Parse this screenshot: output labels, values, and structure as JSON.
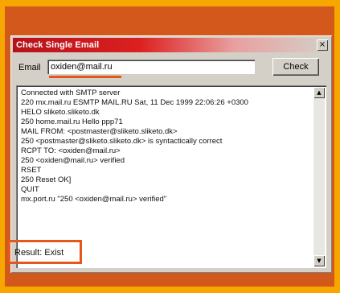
{
  "window": {
    "title": "Check Single Email",
    "close_glyph": "×"
  },
  "form": {
    "email_label": "Email",
    "email_value": "oxiden@mail.ru",
    "check_label": "Check"
  },
  "log": {
    "lines": [
      "Connected with SMTP server",
      "220 mx.mail.ru ESMTP MAIL.RU Sat, 11 Dec 1999 22:06:26 +0300",
      "HELO sliketo.sliketo.dk",
      "250 home.mail.ru Hello ppp71",
      "MAIL FROM: <postmaster@sliketo.sliketo.dk>",
      "250 <postmaster@sliketo.sliketo.dk> is syntactically correct",
      "RCPT TO: <oxiden@mail.ru>",
      "250 <oxiden@mail.ru> verified",
      "RSET",
      "250 Reset OK]",
      "QUIT",
      "mx.port.ru \"250 <oxiden@mail.ru> verified\""
    ],
    "scroll_up_glyph": "▲",
    "scroll_down_glyph": "▼"
  },
  "result": {
    "text": "Result: Exist"
  },
  "colors": {
    "background": "#f7a600",
    "panel": "#d2581b",
    "highlight": "#e5581b",
    "titlebar": "#b5121b"
  }
}
